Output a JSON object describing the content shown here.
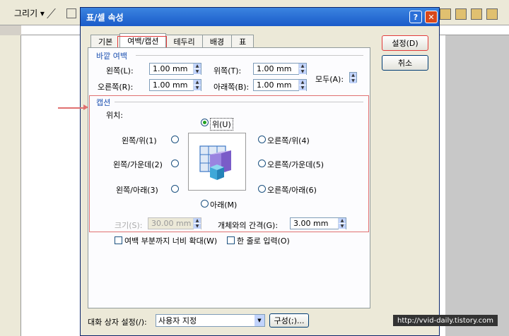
{
  "toolbar": {
    "draw_label": "그리기 ▾"
  },
  "dialog": {
    "title": "표/셀 속성",
    "help_btn": "?",
    "close_btn": "✕",
    "tabs": [
      "기본",
      "여백/캡션",
      "테두리",
      "배경",
      "표"
    ],
    "outer_margin": {
      "group_title": "바깥 여백",
      "left_label": "왼쪽(L):",
      "left_value": "1.00 mm",
      "top_label": "위쪽(T):",
      "top_value": "1.00 mm",
      "right_label": "오른쪽(R):",
      "right_value": "1.00 mm",
      "bottom_label": "아래쪽(B):",
      "bottom_value": "1.00 mm",
      "all_label": "모두(A):"
    },
    "caption": {
      "group_title": "캡션",
      "position_label": "위치:",
      "top": "위(U)",
      "left_top": "왼쪽/위(1)",
      "left_middle": "왼쪽/가운데(2)",
      "left_bottom": "왼쪽/아래(3)",
      "right_top": "오른쪽/위(4)",
      "right_middle": "오른쪽/가운데(5)",
      "right_bottom": "오른쪽/아래(6)",
      "bottom": "아래(M)",
      "size_label": "크기(S):",
      "size_value": "30.00 mm",
      "gap_label": "개체와의 간격(G):",
      "gap_value": "3.00 mm"
    },
    "options": {
      "extend_label": "여백 부분까지 너비 확대(W)",
      "single_line_label": "한 줄로 입력(O)"
    },
    "buttons": {
      "ok": "설정(D)",
      "cancel": "취소"
    },
    "footer": {
      "settings_label": "대화 상자 설정(/):",
      "settings_value": "사용자 지정",
      "config_button": "구성(;)..."
    }
  },
  "watermark": "http://vvid-daily.tistory.com"
}
